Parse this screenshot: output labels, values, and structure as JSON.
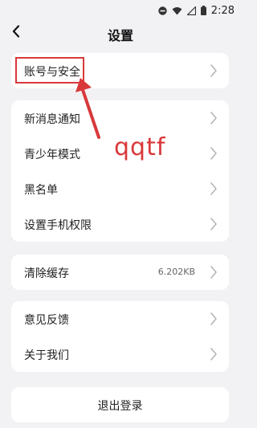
{
  "status_bar": {
    "time": "2:28"
  },
  "header": {
    "title": "设置"
  },
  "groups": [
    {
      "items": [
        {
          "label": "账号与安全"
        }
      ]
    },
    {
      "items": [
        {
          "label": "新消息通知"
        },
        {
          "label": "青少年模式"
        },
        {
          "label": "黑名单"
        },
        {
          "label": "设置手机权限"
        }
      ]
    },
    {
      "items": [
        {
          "label": "清除缓存",
          "value": "6.202KB"
        }
      ]
    },
    {
      "items": [
        {
          "label": "意见反馈"
        },
        {
          "label": "关于我们"
        }
      ]
    }
  ],
  "logout": {
    "label": "退出登录"
  },
  "annotation": {
    "text": "qqtf",
    "color": "#d9383a"
  },
  "colors": {
    "background": "#f2f2f4",
    "card": "#ffffff",
    "annotation": "#d9383a"
  }
}
